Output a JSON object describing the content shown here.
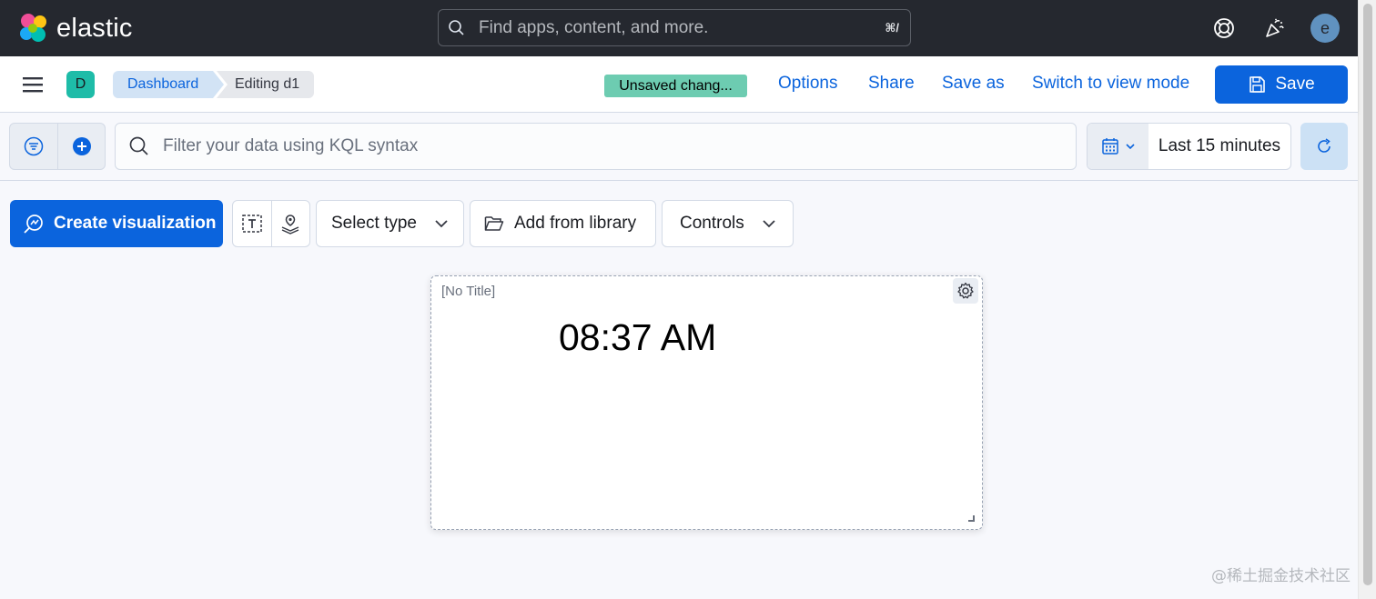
{
  "header": {
    "brand": "elastic",
    "search_placeholder": "Find apps, content, and more.",
    "search_shortcut": "⌘/",
    "user_initial": "e"
  },
  "appbar": {
    "space_initial": "D",
    "breadcrumbs": [
      "Dashboard",
      "Editing d1"
    ],
    "unsaved_badge": "Unsaved chang...",
    "links": [
      "Options",
      "Share",
      "Save as",
      "Switch to view mode"
    ],
    "save_label": "Save"
  },
  "query": {
    "kql_placeholder": "Filter your data using KQL syntax",
    "time_range": "Last 15 minutes"
  },
  "toolbar": {
    "create_label": "Create visualization",
    "select_type_label": "Select type",
    "add_library_label": "Add from library",
    "controls_label": "Controls"
  },
  "panel": {
    "title": "[No Title]",
    "clock_value": "08:37 AM"
  },
  "watermark": "@稀土掘金技术社区",
  "colors": {
    "header_bg": "#25282f",
    "primary": "#0b64dd",
    "unsaved_bg": "#6dccb1",
    "space_badge": "#1ebca8"
  }
}
